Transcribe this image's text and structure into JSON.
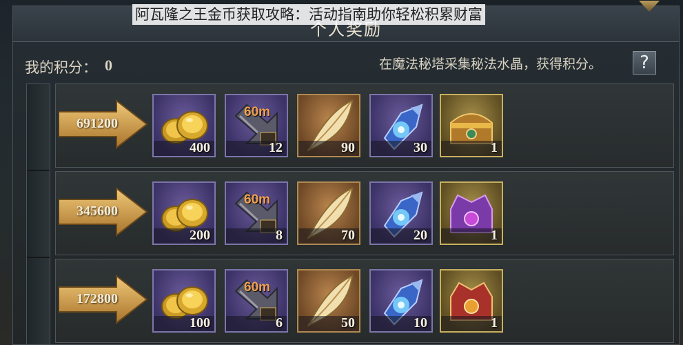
{
  "caption": "阿瓦隆之王金币获取攻略：活动指南助你轻松积累财富",
  "panel": {
    "title": "个人奖励"
  },
  "score": {
    "label": "我的积分：",
    "value": "0"
  },
  "hint": "在魔法秘塔采集秘法水晶，获得积分。",
  "help_label": "?",
  "tiers": [
    {
      "threshold": "691200",
      "rewards": [
        {
          "icon": "gold-coins-icon",
          "count": "400"
        },
        {
          "icon": "speedup-60m-icon",
          "badge": "60m",
          "count": "12"
        },
        {
          "icon": "feather-icon",
          "count": "90"
        },
        {
          "icon": "blue-crystal-icon",
          "count": "30"
        },
        {
          "icon": "golden-chest-icon",
          "count": "1"
        }
      ]
    },
    {
      "threshold": "345600",
      "rewards": [
        {
          "icon": "gold-coins-icon",
          "count": "200"
        },
        {
          "icon": "speedup-60m-icon",
          "badge": "60m",
          "count": "8"
        },
        {
          "icon": "feather-icon",
          "count": "70"
        },
        {
          "icon": "blue-crystal-icon",
          "count": "20"
        },
        {
          "icon": "purple-chest-icon",
          "count": "1"
        }
      ]
    },
    {
      "threshold": "172800",
      "rewards": [
        {
          "icon": "gold-coins-icon",
          "count": "100"
        },
        {
          "icon": "speedup-60m-icon",
          "badge": "60m",
          "count": "6"
        },
        {
          "icon": "feather-icon",
          "count": "50"
        },
        {
          "icon": "blue-crystal-icon",
          "count": "10"
        },
        {
          "icon": "red-chest-icon",
          "count": "1"
        }
      ]
    }
  ],
  "colors": {
    "arrow": "#d9a95a",
    "panel_bg": "#262e34",
    "text": "#ddd6c4"
  }
}
